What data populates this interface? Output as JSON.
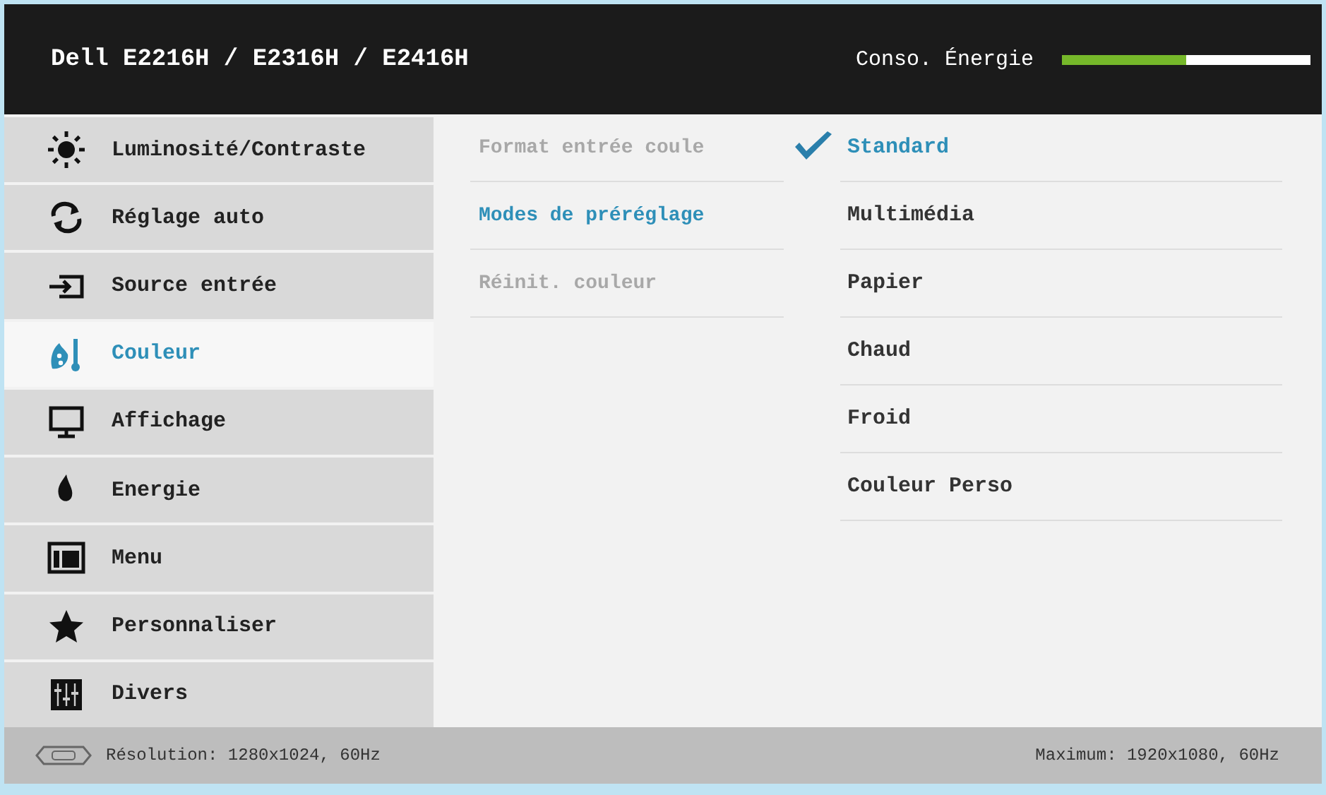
{
  "header": {
    "title": "Dell E2216H / E2316H / E2416H",
    "energy_label": "Conso. Énergie",
    "energy": {
      "level": 0.5
    }
  },
  "sidebar": {
    "items": [
      {
        "label": "Luminosité/Contraste",
        "selected": false
      },
      {
        "label": "Réglage auto",
        "selected": false
      },
      {
        "label": "Source entrée",
        "selected": false
      },
      {
        "label": "Couleur",
        "selected": true
      },
      {
        "label": "Affichage",
        "selected": false
      },
      {
        "label": "Energie",
        "selected": false
      },
      {
        "label": "Menu",
        "selected": false
      },
      {
        "label": "Personnaliser",
        "selected": false
      },
      {
        "label": "Divers",
        "selected": false
      }
    ]
  },
  "options": [
    {
      "label": "Format entrée coule",
      "disabled": true,
      "selected": false
    },
    {
      "label": "Modes de préréglage",
      "disabled": false,
      "selected": true
    },
    {
      "label": "Réinit. couleur",
      "disabled": true,
      "selected": false
    }
  ],
  "presets": [
    {
      "label": "Standard",
      "checked": true
    },
    {
      "label": "Multimédia",
      "checked": false
    },
    {
      "label": "Papier",
      "checked": false
    },
    {
      "label": "Chaud",
      "checked": false
    },
    {
      "label": "Froid",
      "checked": false
    },
    {
      "label": "Couleur Perso",
      "checked": false
    }
  ],
  "status_bar": {
    "resolution": "Résolution: 1280x1024, 60Hz",
    "maximum": "Maximum: 1920x1080, 60Hz"
  }
}
